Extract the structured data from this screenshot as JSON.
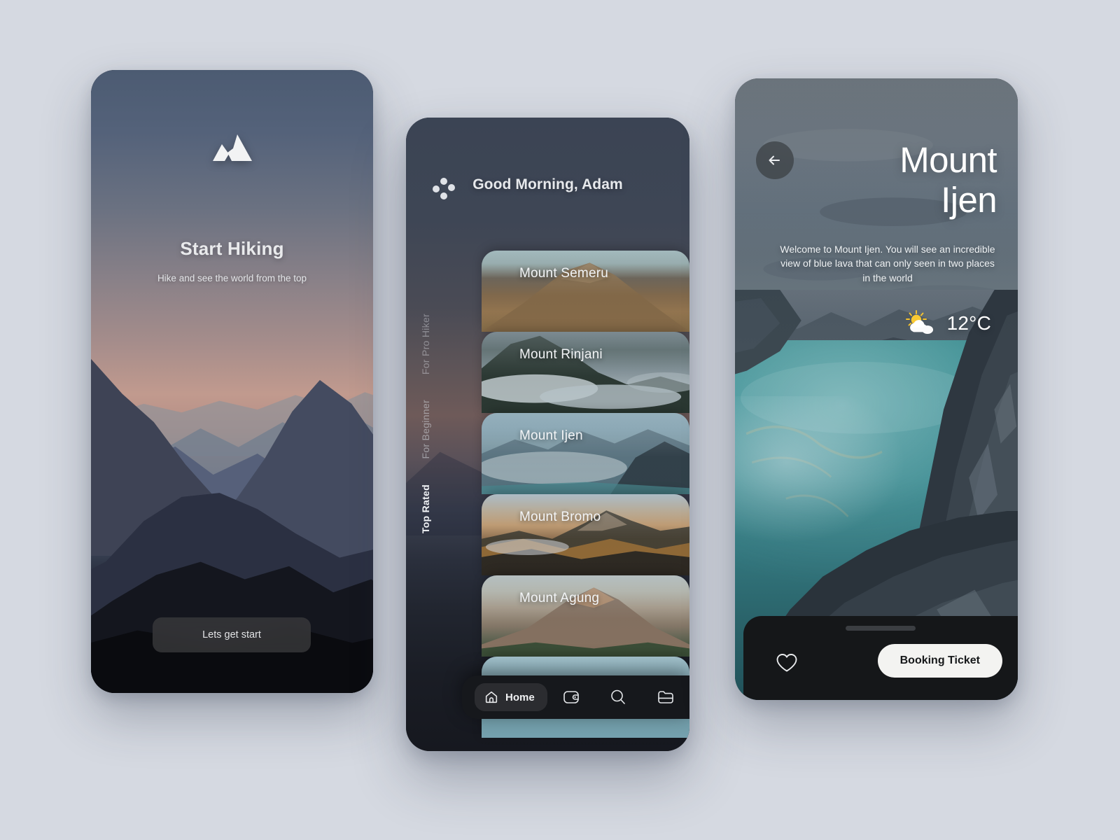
{
  "canvas": {
    "background": "#d5d9e1"
  },
  "onboarding": {
    "logo_icon": "mountain-logo-icon",
    "title": "Start Hiking",
    "subtitle": "Hike and see the world from the top",
    "cta_label": "Lets get start"
  },
  "home": {
    "menu_icon": "grid-dots-menu-icon",
    "greeting": "Good Morning, Adam",
    "side_tabs": [
      {
        "label": "For Pro Hiker",
        "active": false
      },
      {
        "label": "For Beginner",
        "active": false
      },
      {
        "label": "Top Rated",
        "active": true
      }
    ],
    "cards": [
      {
        "name": "Mount Semeru"
      },
      {
        "name": "Mount Rinjani"
      },
      {
        "name": "Mount Ijen"
      },
      {
        "name": "Mount Bromo"
      },
      {
        "name": "Mount Agung"
      }
    ],
    "nav": [
      {
        "label": "Home",
        "icon": "home-icon",
        "active": true
      },
      {
        "label": "",
        "icon": "wallet-icon",
        "active": false
      },
      {
        "label": "",
        "icon": "search-icon",
        "active": false
      },
      {
        "label": "",
        "icon": "folder-icon",
        "active": false
      }
    ]
  },
  "detail": {
    "back_icon": "arrow-left-icon",
    "title_line1": "Mount",
    "title_line2": "Ijen",
    "description": "Welcome to Mount Ijen. You will see an incredible view of blue lava that can only seen in two places in the world",
    "weather_icon": "sun-behind-cloud-icon",
    "temperature": "12°C",
    "favorite_icon": "heart-outline-icon",
    "book_label": "Booking Ticket"
  },
  "colors": {
    "page_bg": "#d5d9e1",
    "cta_light": "#f3f3f1",
    "lake_teal": "#3e8e92",
    "sheet_dark": "#151719",
    "nav_dark": "#16181c"
  }
}
